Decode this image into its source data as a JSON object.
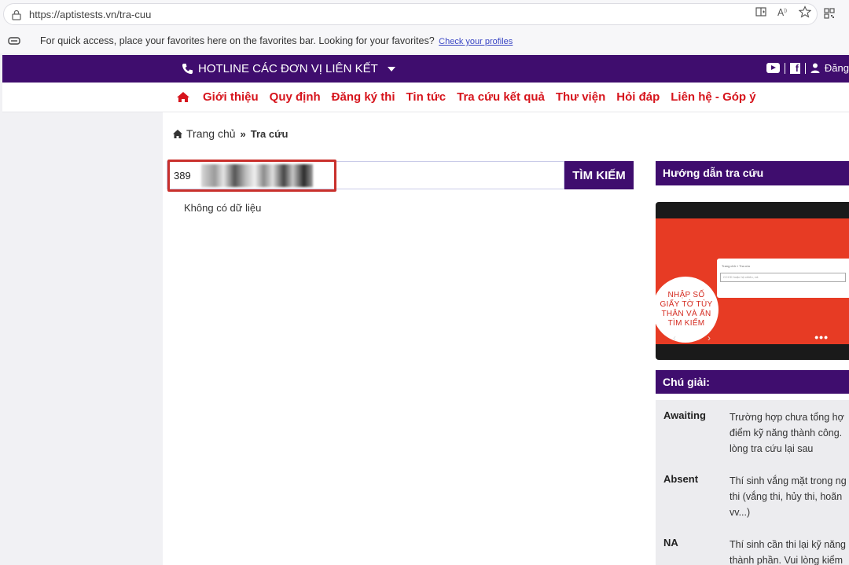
{
  "browser": {
    "url": "https://aptistests.vn/tra-cuu",
    "favorites_text": "For quick access, place your favorites here on the favorites bar. Looking for your favorites?",
    "favorites_link": "Check your profiles"
  },
  "topbar": {
    "hotline": "HOTLINE CÁC ĐƠN VỊ LIÊN KẾT",
    "login": "Đăng"
  },
  "nav": {
    "items": [
      "Giới thiệu",
      "Quy định",
      "Đăng ký thi",
      "Tin tức",
      "Tra cứu kết quả",
      "Thư viện",
      "Hỏi đáp",
      "Liên hệ - Góp ý"
    ]
  },
  "breadcrumb": {
    "home": "Trang chủ",
    "current": "Tra cứu"
  },
  "search": {
    "value": "389",
    "button": "TÌM KIẾM"
  },
  "result": {
    "message": "Không có dữ liệu"
  },
  "sidebar": {
    "guide_title": "Hướng dẫn tra cứu",
    "video": {
      "screen_breadcrumb": "Trang chủ » Tra cứu",
      "screen_placeholder": "CCCD hoặc hộ chiếu, vd:",
      "caption_lines": [
        "NHẬP SỐ",
        "GIẤY TỜ TÙY",
        "THÂN VÀ ẤN",
        "TÌM KIẾM"
      ]
    },
    "legend_title": "Chú giải:",
    "legend": [
      {
        "key": "Awaiting",
        "lines": [
          "Trường hợp chưa tổng hợ",
          "điểm kỹ năng thành công.",
          "lòng tra cứu lại sau"
        ]
      },
      {
        "key": "Absent",
        "lines": [
          "Thí sinh vắng mặt trong ng",
          "thi (vắng thi, hủy thi, hoãn",
          "vv...)"
        ]
      },
      {
        "key": "NA",
        "lines": [
          "Thí sinh cần thi lại kỹ năng",
          "thành phần. Vui lòng kiểm"
        ]
      }
    ]
  },
  "colors": {
    "brand_purple": "#3f0d6e",
    "nav_red": "#d6141c",
    "highlight_red": "#c9302c"
  }
}
